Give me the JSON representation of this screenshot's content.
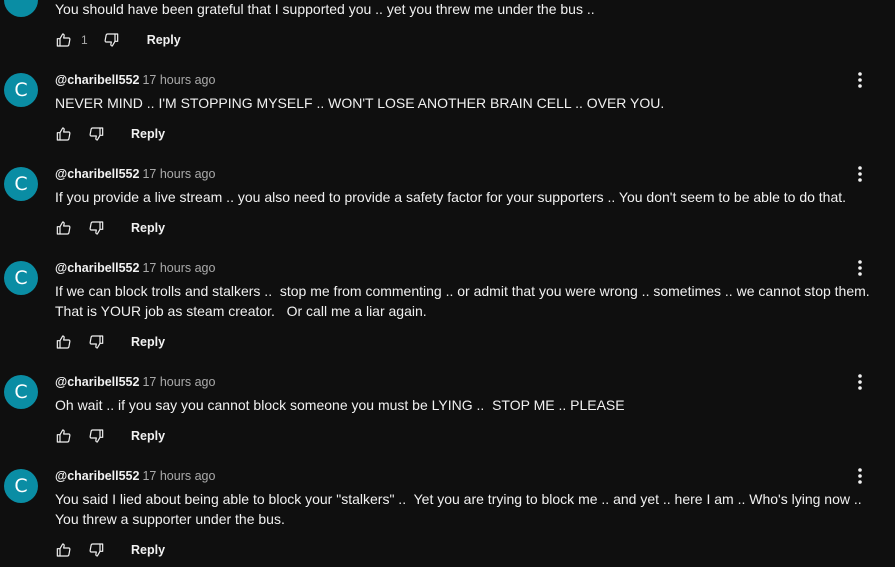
{
  "comments": [
    {
      "avatar_letter": "",
      "author": "",
      "time": "",
      "text": "You should have been grateful that I supported you .. yet you threw me under the bus ..",
      "likes": "1",
      "reply_label": "Reply"
    },
    {
      "avatar_letter": "C",
      "author": "@charibell552",
      "time": "17 hours ago",
      "text": "NEVER MIND .. I'M STOPPING MYSELF .. WON'T LOSE ANOTHER BRAIN CELL .. OVER YOU.",
      "likes": "",
      "reply_label": "Reply"
    },
    {
      "avatar_letter": "C",
      "author": "@charibell552",
      "time": "17 hours ago",
      "text": "If you provide a live stream .. you also need to provide a safety factor for your supporters .. You don't seem to be able to do that.",
      "likes": "",
      "reply_label": "Reply"
    },
    {
      "avatar_letter": "C",
      "author": "@charibell552",
      "time": "17 hours ago",
      "text": "If we can block trolls and stalkers ..  stop me from commenting .. or admit that you were wrong .. sometimes .. we cannot stop them.\nThat is YOUR job as steam creator.   Or call me a liar again.",
      "likes": "",
      "reply_label": "Reply"
    },
    {
      "avatar_letter": "C",
      "author": "@charibell552",
      "time": "17 hours ago",
      "text": "Oh wait .. if you say you cannot block someone you must be LYING ..  STOP ME .. PLEASE",
      "likes": "",
      "reply_label": "Reply"
    },
    {
      "avatar_letter": "C",
      "author": "@charibell552",
      "time": "17 hours ago",
      "text": "You said I lied about being able to block your \"stalkers\" ..  Yet you are trying to block me .. and yet .. here I am .. Who's lying now .. You threw a supporter under the bus.",
      "likes": "",
      "reply_label": "Reply"
    }
  ],
  "icons": {
    "like": "thumbs-up-icon",
    "dislike": "thumbs-down-icon",
    "more": "more-vertical-icon"
  },
  "colors": {
    "background": "#0f0f0f",
    "avatar": "#0a8da4",
    "text": "#f1f1f1",
    "muted": "#aaaaaa"
  }
}
